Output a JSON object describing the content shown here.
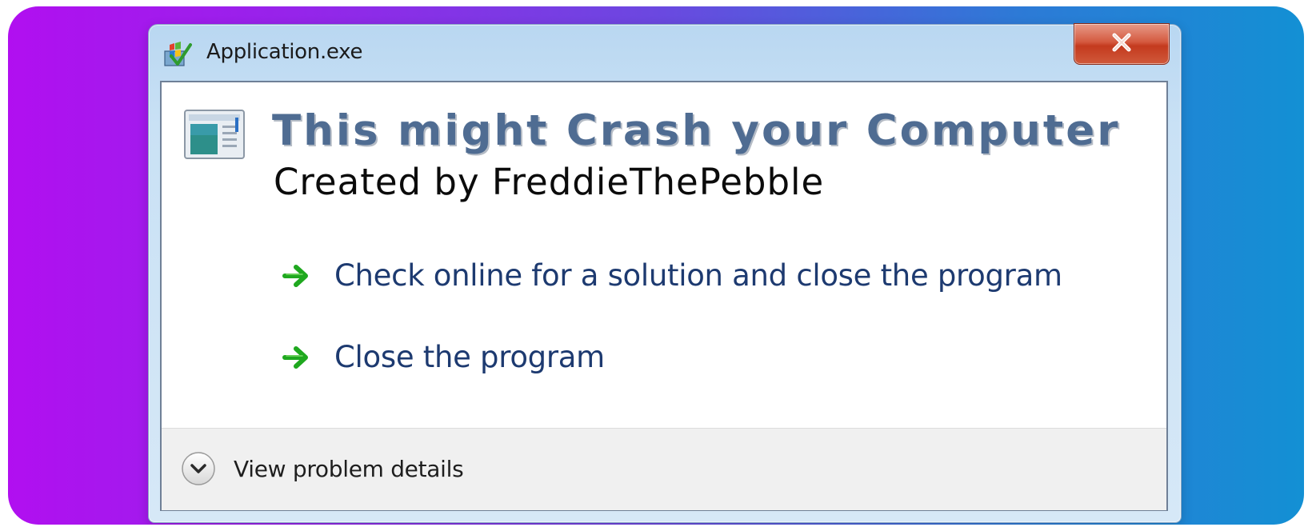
{
  "window": {
    "title": "Application.exe"
  },
  "message": {
    "heading": "This might Crash your Computer",
    "subheading": "Created by FreddieThePebble"
  },
  "options": [
    {
      "label": "Check online for a solution and close the program"
    },
    {
      "label": "Close the program"
    }
  ],
  "footer": {
    "details_label": "View problem details"
  },
  "colors": {
    "backdrop_left": "#b10ff0",
    "backdrop_right": "#1390d4",
    "heading": "#4f6c92",
    "option_text": "#1d3a70",
    "arrow_green": "#1fa81f",
    "close_button": "#c43a1e"
  },
  "icons": {
    "app": "windows-flag-app-icon",
    "close": "close-icon",
    "program": "program-window-icon",
    "option_arrow": "green-arrow-icon",
    "details_toggle": "chevron-down-icon"
  }
}
